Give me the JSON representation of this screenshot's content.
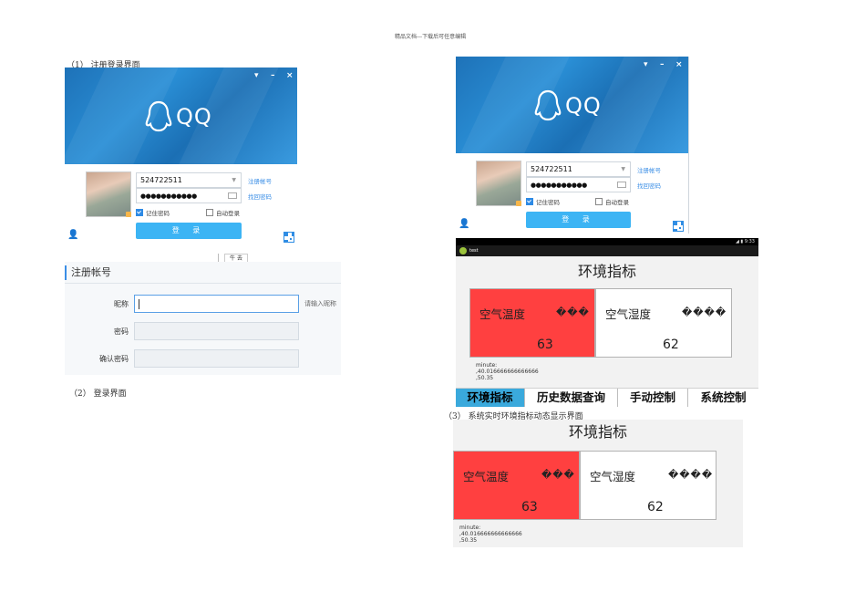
{
  "header_note": "精品文档---下载后可任意编辑",
  "captions": {
    "c1": "（1） 注册登录界面",
    "c2": "（2） 登录界面",
    "c3": "（3） 系统实时环境指标动态显示界面"
  },
  "qq_login": {
    "logo_text": "QQ",
    "account": "524722511",
    "password_mask": "●●●●●●●●●●●",
    "register_link": "注册帐号",
    "forgot_link": "找回密码",
    "remember": "记住密码",
    "auto_login": "自动登录",
    "login_button": "登 录",
    "close_glyph": "×",
    "minimize_glyph": "–",
    "menu_glyph": "▾",
    "under_label": "牛 去"
  },
  "register": {
    "title": "注册帐号",
    "nickname_label": "昵称",
    "nickname_hint": "请输入昵称",
    "password_label": "密码",
    "confirm_label": "确认密码"
  },
  "env_app": {
    "app_name": "test",
    "status": "◢ ▮ 9:33",
    "title": "环境指标",
    "temp_label": "空气温度",
    "humid_label": "空气湿度",
    "temp_unknown": "���",
    "humid_unknown": "����",
    "temp_value": "63",
    "humid_value": "62",
    "log_line1": "minute:",
    "log_line2": ",40.016666666666666",
    "log_line3": ",50.35",
    "tabs": [
      "环境指标",
      "历史数据查询",
      "手动控制",
      "系统控制"
    ]
  },
  "colors": {
    "qq_blue": "#1e72b8",
    "login_button": "#3cb4f4",
    "temp_tile": "#ff4040",
    "selected_tab": "#3aa9dc"
  }
}
